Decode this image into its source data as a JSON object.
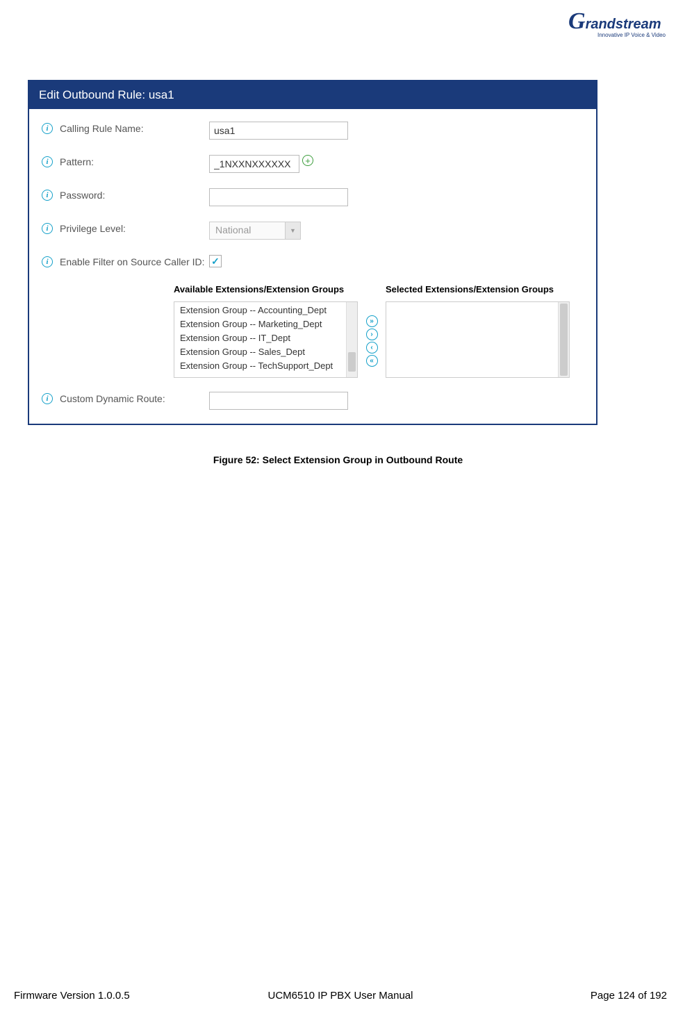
{
  "logo": {
    "brand_g": "G",
    "brand_rest": "randstream",
    "tagline": "Innovative IP Voice & Video"
  },
  "dialog": {
    "title": "Edit Outbound Rule: usa1",
    "labels": {
      "calling_rule_name": "Calling Rule Name:",
      "pattern": "Pattern:",
      "password": "Password:",
      "privilege_level": "Privilege Level:",
      "enable_filter": "Enable Filter on Source Caller ID:",
      "custom_dynamic_route": "Custom Dynamic Route:"
    },
    "values": {
      "calling_rule_name": "usa1",
      "pattern": "_1NXXNXXXXXX",
      "password": "",
      "privilege_level": "National",
      "enable_filter_checked": true,
      "custom_dynamic_route": ""
    },
    "dual_list": {
      "available_header": "Available Extensions/Extension Groups",
      "selected_header": "Selected Extensions/Extension Groups",
      "available_items": [
        "Extension Group -- Accounting_Dept",
        "Extension Group -- Marketing_Dept",
        "Extension Group -- IT_Dept",
        "Extension Group -- Sales_Dept",
        "Extension Group -- TechSupport_Dept"
      ],
      "selected_items": []
    }
  },
  "caption": "Figure 52: Select Extension Group in Outbound Route",
  "footer": {
    "left": "Firmware Version 1.0.0.5",
    "center": "UCM6510 IP PBX User Manual",
    "right": "Page 124 of 192"
  }
}
